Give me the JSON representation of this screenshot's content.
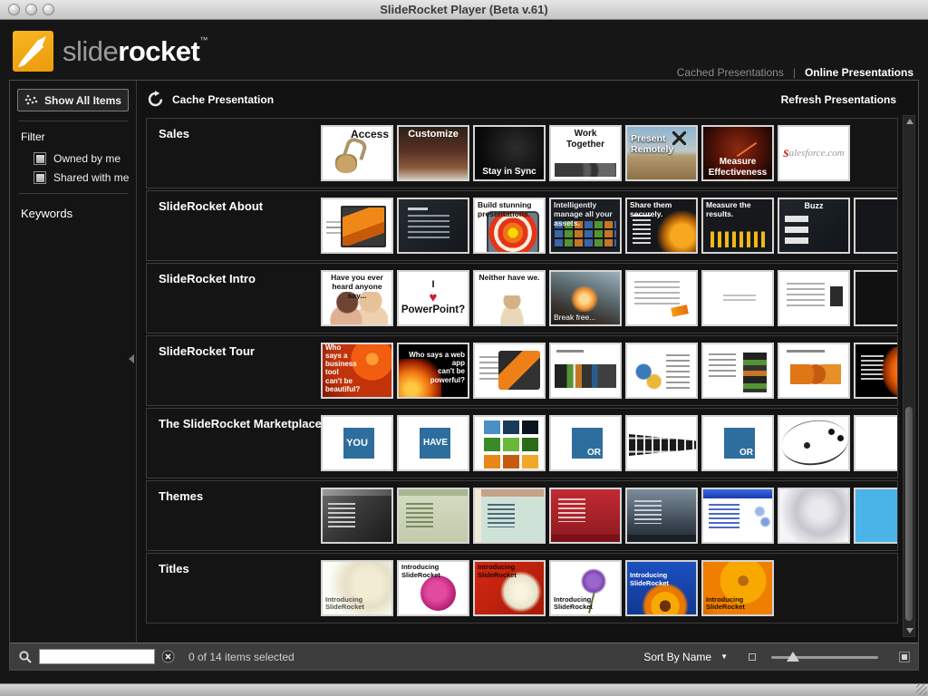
{
  "window": {
    "title": "SlideRocket Player (Beta v.61)"
  },
  "brand": {
    "logo_light": "slide",
    "logo_bold": "rocket",
    "tm": "™"
  },
  "nav": {
    "cached": "Cached Presentations",
    "separator": "|",
    "online": "Online Presentations"
  },
  "toolbar": {
    "show_all": "Show All Items",
    "cache": "Cache Presentation",
    "refresh": "Refresh Presentations"
  },
  "sidebar": {
    "filter_label": "Filter",
    "checkboxes": [
      {
        "label": "Owned by me",
        "checked": false
      },
      {
        "label": "Shared with me",
        "checked": false
      }
    ],
    "keywords_label": "Keywords"
  },
  "library": {
    "rows": [
      {
        "title": "Sales",
        "thumbs": [
          {
            "style": "s-access",
            "label": "Access"
          },
          {
            "style": "s-customize",
            "label": "Customize"
          },
          {
            "style": "s-sync",
            "label": "Stay in Sync"
          },
          {
            "style": "s-work",
            "label": "Work\nTogether"
          },
          {
            "style": "s-remote",
            "label": "Present\nRemotely"
          },
          {
            "style": "s-measure",
            "label": "Measure\nEffectiveness"
          },
          {
            "style": "s-sf",
            "labels": [
              {
                "t": "s",
                "c": "sfred"
              },
              {
                "t": "alesforce.com",
                "c": "sfgray"
              }
            ]
          }
        ]
      },
      {
        "title": "SlideRocket About",
        "thumbs": [
          {
            "style": "a-shot",
            "label": ""
          },
          {
            "style": "a-darktext",
            "label": ""
          },
          {
            "style": "a-target",
            "label": "Build stunning presentations."
          },
          {
            "style": "a-assets",
            "label": "Intelligently manage all your assets."
          },
          {
            "style": "a-secure",
            "label": "Share them securely."
          },
          {
            "style": "a-results",
            "label": "Measure the results."
          },
          {
            "style": "a-buzz",
            "label": "Buzz"
          },
          {
            "style": "a-people",
            "label": ""
          }
        ]
      },
      {
        "title": "SlideRocket Intro",
        "thumbs": [
          {
            "style": "i-heard",
            "label": "Have you ever heard anyone say..."
          },
          {
            "style": "i-love",
            "labels": [
              {
                "t": "I"
              },
              {
                "t": "♥",
                "c": "heart"
              },
              {
                "t": "PowerPoint?"
              }
            ]
          },
          {
            "style": "i-neither",
            "label": "Neither have we."
          },
          {
            "style": "i-launch",
            "label": "Break free..."
          },
          {
            "style": "i-text1",
            "label": ""
          },
          {
            "style": "i-plain",
            "label": ""
          },
          {
            "style": "i-text2",
            "label": ""
          },
          {
            "style": "i-dark",
            "label": ""
          }
        ]
      },
      {
        "title": "SlideRocket Tour",
        "thumbs": [
          {
            "style": "t-gerbera",
            "label": "Who says a business tool can't be beautiful?"
          },
          {
            "style": "t-fire",
            "label": "Who says a web app\ncan't be powerful?"
          },
          {
            "style": "t-shot1",
            "label": ""
          },
          {
            "style": "t-shot2",
            "label": ""
          },
          {
            "style": "t-shot3",
            "label": ""
          },
          {
            "style": "t-shot4",
            "label": ""
          },
          {
            "style": "t-shot5",
            "label": ""
          },
          {
            "style": "t-blackflower",
            "label": ""
          },
          {
            "style": "t-green",
            "label": ""
          }
        ]
      },
      {
        "title": "The SlideRocket Marketplace",
        "thumbs": [
          {
            "style": "m-you",
            "label": "YOU"
          },
          {
            "style": "m-have",
            "label": "HAVE"
          },
          {
            "style": "m-grid",
            "label": ""
          },
          {
            "style": "m-or",
            "label": "OR"
          },
          {
            "style": "m-film",
            "label": ""
          },
          {
            "style": "m-or",
            "label": "OR"
          },
          {
            "style": "m-music",
            "label": ""
          },
          {
            "style": "m-white",
            "label": ""
          }
        ]
      },
      {
        "title": "Themes",
        "thumbs": [
          {
            "style": "th-dark",
            "label": ""
          },
          {
            "style": "th-sage",
            "label": ""
          },
          {
            "style": "th-tan",
            "label": ""
          },
          {
            "style": "th-red",
            "label": ""
          },
          {
            "style": "th-slate",
            "label": ""
          },
          {
            "style": "th-blue",
            "label": ""
          },
          {
            "style": "th-smoke",
            "label": ""
          },
          {
            "style": "th-cyan",
            "label": ""
          }
        ]
      },
      {
        "title": "Titles",
        "thumbs": [
          {
            "style": "ti-cream",
            "label": "Introducing SlideRocket"
          },
          {
            "style": "ti-pink",
            "label": "Introducing SlideRocket"
          },
          {
            "style": "ti-reddaisy",
            "label": "Introducing SlideRocket"
          },
          {
            "style": "ti-purple",
            "label": "Introducing SlideRocket"
          },
          {
            "style": "ti-sunflower",
            "label": "Introducing SlideRocket"
          },
          {
            "style": "ti-orange",
            "label": "Introducing SlideRocket"
          }
        ]
      }
    ]
  },
  "statusbar": {
    "search_value": "",
    "selection": "0 of 14 items selected",
    "sort_label": "Sort By Name",
    "sort_arrow": "▼"
  },
  "colors": {
    "brand_yellow": "#F2A51C",
    "marketplace_blue": "#2E6E9E",
    "heart_red": "#CC1F2E",
    "salesforce_red": "#CC2A1E",
    "theme_red": "#B5242E",
    "title_blue": "#1C50C0"
  }
}
